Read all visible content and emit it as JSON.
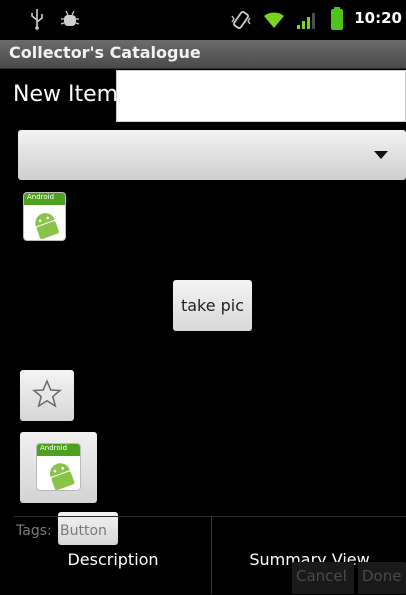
{
  "status_bar": {
    "time": "10:20",
    "icons": [
      "usb-icon",
      "debug-icon",
      "vibrate-icon",
      "wifi-icon",
      "signal-icon",
      "battery-icon"
    ]
  },
  "app": {
    "title": "Collector's Catalogue"
  },
  "form": {
    "new_item_label": "New Item",
    "new_item_value": "",
    "spinner_value": "",
    "take_pic_label": "take pic",
    "tags_label": "Tags:",
    "tags_button_label": "Button",
    "icon_band_text": "Android"
  },
  "tabs": [
    {
      "label": "Description"
    },
    {
      "label": "Summary View"
    }
  ],
  "actions": {
    "cancel_label": "Cancel",
    "done_label": "Done"
  },
  "colors": {
    "background": "#000000",
    "android_green": "#4da11f",
    "wifi_green": "#7dd321",
    "battery_green": "#4ec31c"
  }
}
